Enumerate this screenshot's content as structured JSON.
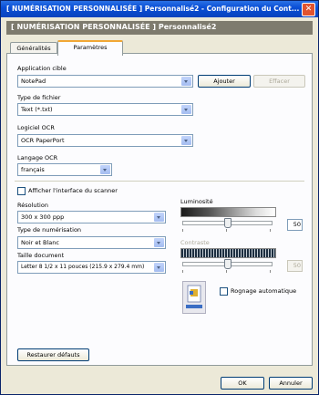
{
  "titlebar": {
    "title": "[ NUMÉRISATION PERSONNALISÉE ]  Personnalisé2 - Configuration du Cont...",
    "close_glyph": "✕"
  },
  "header": {
    "text": "[ NUMÉRISATION PERSONNALISÉE ]    Personnalisé2"
  },
  "tabs": [
    {
      "label": "Généralités",
      "active": false
    },
    {
      "label": "Paramètres",
      "active": true
    }
  ],
  "app": {
    "label": "Application cible",
    "value": "NotePad",
    "add_button": "Ajouter",
    "delete_button": "Effacer"
  },
  "filetype": {
    "label": "Type de fichier",
    "value": "Text (*.txt)"
  },
  "ocr_software": {
    "label": "Logiciel OCR",
    "value": "OCR PaperPort"
  },
  "ocr_language": {
    "label": "Langage OCR",
    "value": "français"
  },
  "show_scanner_ui": {
    "label": "Afficher l'interface du scanner",
    "checked": false
  },
  "resolution": {
    "label": "Résolution",
    "value": "300 x 300 ppp"
  },
  "scan_type": {
    "label": "Type de numérisation",
    "value": "Noir et Blanc"
  },
  "doc_size": {
    "label": "Taille document",
    "value": "Letter 8 1/2 x 11 pouces (215.9 x 279.4 mm)"
  },
  "brightness": {
    "label": "Luminosité",
    "value": "50",
    "level": 0.5,
    "enabled": true
  },
  "contrast": {
    "label": "Contraste",
    "value": "50",
    "level": 0.5,
    "enabled": false
  },
  "auto_crop": {
    "label": "Rognage automatique",
    "checked": false
  },
  "restore_button": "Restaurer défauts",
  "ok_button": "OK",
  "cancel_button": "Annuler",
  "colors": {
    "titlebar": "#0a4fd6",
    "header": "#7e7b6e",
    "window_bg": "#ece9d8",
    "tab_highlight": "#f1a735"
  }
}
